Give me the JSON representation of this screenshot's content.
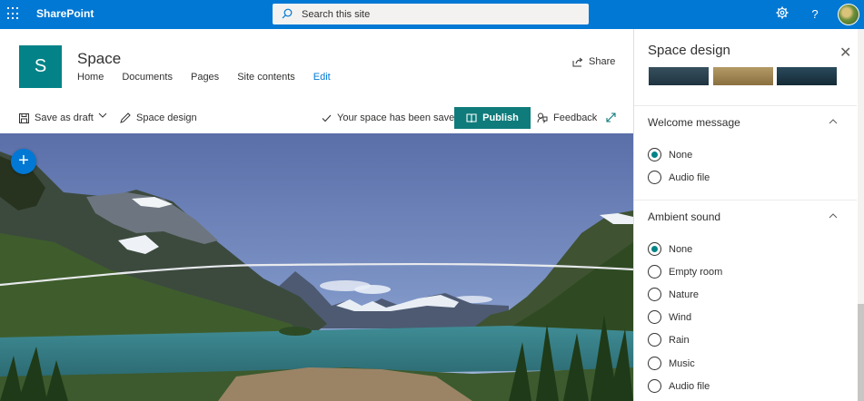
{
  "suite": {
    "brand": "SharePoint",
    "search_placeholder": "Search this site",
    "settings_icon": "gear-icon",
    "help_label": "?"
  },
  "site": {
    "logo_letter": "S",
    "title": "Space",
    "nav": [
      "Home",
      "Documents",
      "Pages",
      "Site contents",
      "Edit"
    ],
    "share_label": "Share"
  },
  "commandbar": {
    "save_draft": "Save as draft",
    "space_design": "Space design",
    "saved_status": "Your space has been saved",
    "publish": "Publish",
    "feedback": "Feedback"
  },
  "canvas": {
    "add_label": "+"
  },
  "pane": {
    "title": "Space design",
    "close_label": "✕",
    "welcome": {
      "title": "Welcome message",
      "options": [
        "None",
        "Audio file"
      ],
      "selected": "None"
    },
    "ambient": {
      "title": "Ambient sound",
      "options": [
        "None",
        "Empty room",
        "Nature",
        "Wind",
        "Rain",
        "Music",
        "Audio file"
      ],
      "selected": "None"
    }
  },
  "colors": {
    "suite_bar": "#0078d4",
    "publish_bg": "#0f7b7b",
    "site_logo": "#038387",
    "add_button": "#0078d4"
  }
}
